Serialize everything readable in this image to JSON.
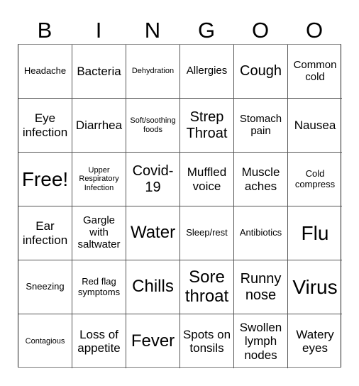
{
  "header": [
    "B",
    "I",
    "N",
    "G",
    "O",
    "O"
  ],
  "cells": [
    "Headache",
    "Bacteria",
    "Dehydration",
    "Allergies",
    "Cough",
    "Common cold",
    "Eye infection",
    "Diarrhea",
    "Soft/soothing foods",
    "Strep Throat",
    "Stomach pain",
    "Nausea",
    "Free!",
    "Upper Respiratory Infection",
    "Covid-19",
    "Muffled voice",
    "Muscle aches",
    "Cold compress",
    "Ear infection",
    "Gargle with saltwater",
    "Water",
    "Sleep/rest",
    "Antibiotics",
    "Flu",
    "Sneezing",
    "Red flag symptoms",
    "Chills",
    "Sore throat",
    "Runny nose",
    "Virus",
    "Contagious",
    "Loss of appetite",
    "Fever",
    "Spots on tonsils",
    "Swollen lymph nodes",
    "Watery eyes"
  ]
}
